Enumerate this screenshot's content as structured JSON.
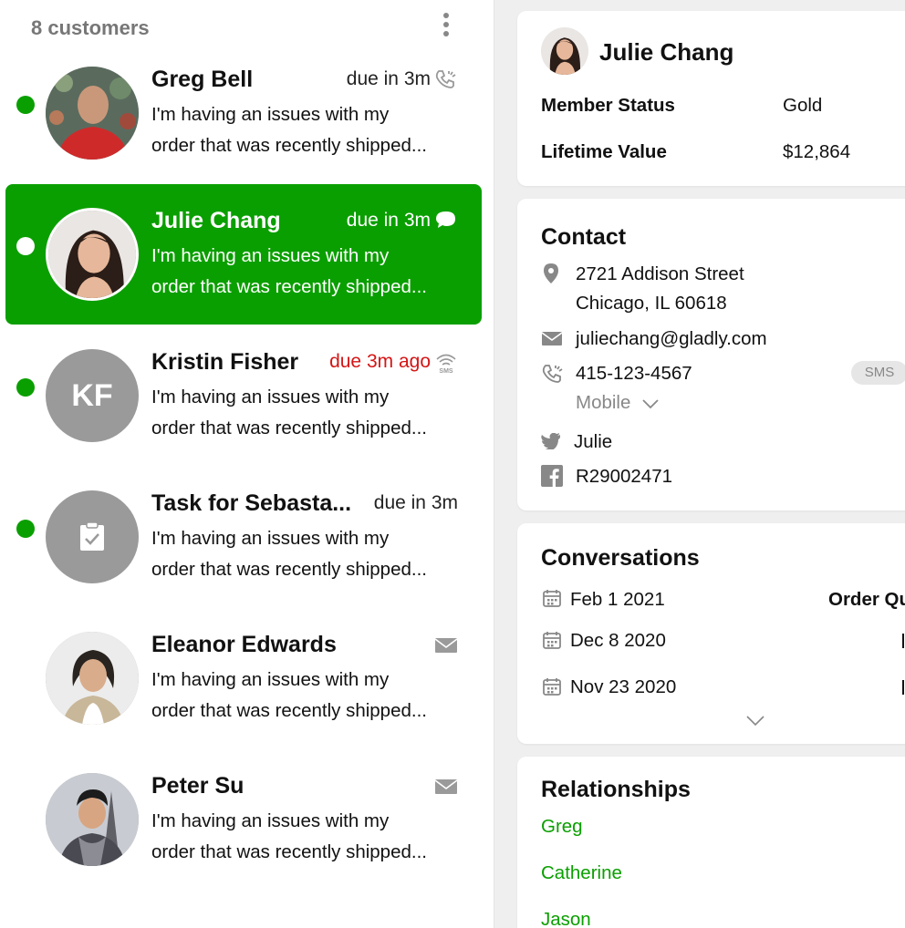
{
  "inbox": {
    "count_label": "8 customers",
    "items": [
      {
        "name": "Greg Bell",
        "due": "due in 3m",
        "line1": "I'm having an issues with my",
        "line2": "order that was recently shipped...",
        "channel": "phone-icon"
      },
      {
        "name": "Julie Chang",
        "due": "due in 3m",
        "line1": "I'm having an issues with my",
        "line2": "order that was recently shipped...",
        "channel": "chat-icon"
      },
      {
        "name": "Kristin Fisher",
        "initials": "KF",
        "due": "due 3m ago",
        "line1": "I'm having an issues with my",
        "line2": "order that was recently shipped...",
        "channel": "sms-icon"
      },
      {
        "name": "Task for Sebasta...",
        "due": "due in 3m",
        "line1": "I'm having an issues with my",
        "line2": "order that was recently shipped...",
        "channel": "task-icon"
      },
      {
        "name": "Eleanor Edwards",
        "due": "",
        "line1": "I'm having an issues with my",
        "line2": "order that was recently shipped...",
        "channel": "email-icon"
      },
      {
        "name": "Peter Su",
        "due": "",
        "line1": "I'm having an issues with my",
        "line2": "order that was recently shipped...",
        "channel": "email-icon"
      }
    ]
  },
  "profile": {
    "name": "Julie Chang",
    "member_status_label": "Member Status",
    "member_status_value": "Gold",
    "lifetime_value_label": "Lifetime Value",
    "lifetime_value_value": "$12,864"
  },
  "contact": {
    "title": "Contact",
    "address_line1": "2721 Addison Street",
    "address_line2": "Chicago, IL 60618",
    "email": "juliechang@gladly.com",
    "phone": "415-123-4567",
    "phone_badge": "SMS",
    "phone_type": "Mobile",
    "twitter": "Julie",
    "facebook": "R29002471"
  },
  "conversations": {
    "title": "Conversations",
    "items": [
      {
        "date": "Feb 1 2021",
        "subject": "Order Qu"
      },
      {
        "date": "Dec 8 2020"
      },
      {
        "date": "Nov 23 2020"
      }
    ]
  },
  "relationships": {
    "title": "Relationships",
    "items": [
      "Greg",
      "Catherine",
      "Jason"
    ]
  },
  "colors": {
    "accent": "#0a9f00",
    "overdue": "#d41515",
    "muted": "#888888"
  }
}
